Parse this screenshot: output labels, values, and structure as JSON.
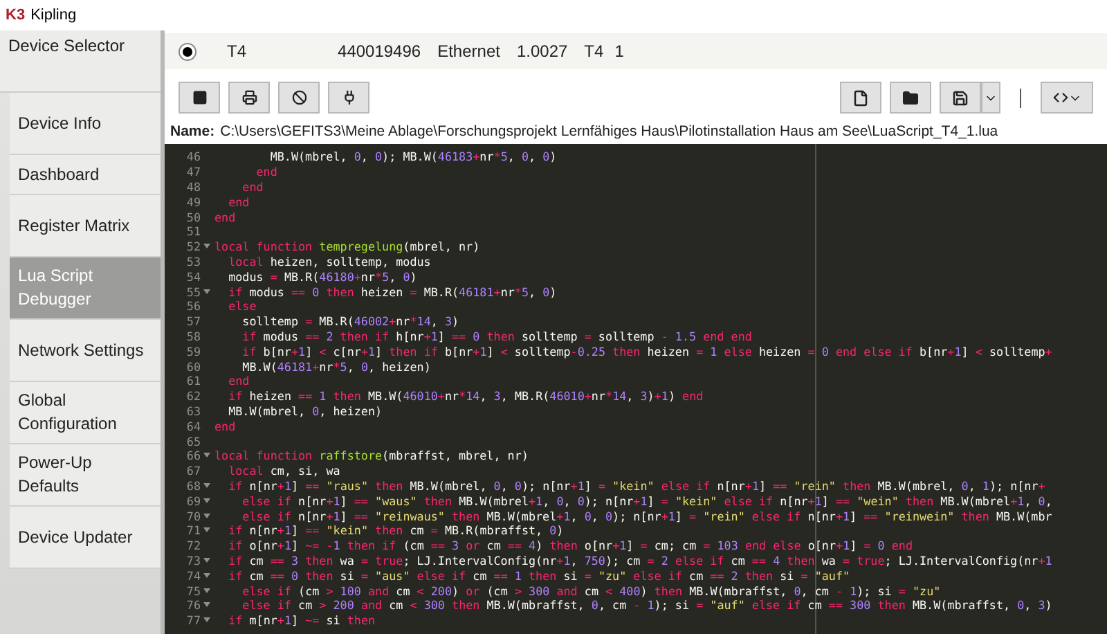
{
  "window": {
    "title": "Kipling",
    "logo": "K3"
  },
  "sidebar": {
    "header": "Device Selector",
    "items": [
      {
        "label": "Device Info",
        "selected": false
      },
      {
        "label": "Dashboard",
        "selected": false
      },
      {
        "label": "Register Matrix",
        "selected": false
      },
      {
        "label": "Lua Script Debugger",
        "selected": true
      },
      {
        "label": "Network Settings",
        "selected": false
      },
      {
        "label": "Global Configuration",
        "selected": false
      },
      {
        "label": "Power-Up Defaults",
        "selected": false
      },
      {
        "label": "Device Updater",
        "selected": false
      }
    ]
  },
  "device": {
    "selected": true,
    "columns": [
      "T4",
      "440019496",
      "Ethernet",
      "1.0027",
      "T4",
      "1"
    ]
  },
  "file": {
    "label": "Name:",
    "path": "C:\\Users\\GEFITS3\\Meine Ablage\\Forschungsprojekt Lernfähiges Haus\\Pilotinstallation Haus am See\\LuaScript_T4_1.lua"
  },
  "editor": {
    "lines": [
      {
        "number": "46",
        "fold": false,
        "code": "        MB.W(mbrel, 0, 0); MB.W(46183+nr*5, 0, 0)"
      },
      {
        "number": "47",
        "fold": false,
        "code": "      end"
      },
      {
        "number": "48",
        "fold": false,
        "code": "    end"
      },
      {
        "number": "49",
        "fold": false,
        "code": "  end"
      },
      {
        "number": "50",
        "fold": false,
        "code": "end"
      },
      {
        "number": "51",
        "fold": false
      },
      {
        "number": "52",
        "fold": true,
        "code": "local function tempregelung(mbrel, nr)"
      },
      {
        "number": "53",
        "fold": false,
        "code": "  local heizen, solltemp, modus"
      },
      {
        "number": "54",
        "fold": false,
        "code": "  modus = MB.R(46180+nr*5, 0)"
      },
      {
        "number": "55",
        "fold": true,
        "code": "  if modus == 0 then heizen = MB.R(46181+nr*5, 0)"
      },
      {
        "number": "56",
        "fold": false,
        "code": "  else"
      },
      {
        "number": "57",
        "fold": false,
        "code": "    solltemp = MB.R(46002+nr*14, 3)"
      },
      {
        "number": "58",
        "fold": false,
        "code": "    if modus == 2 then if h[nr+1] == 0 then solltemp = solltemp - 1.5 end end"
      },
      {
        "number": "59",
        "fold": false,
        "code": "    if b[nr+1] < c[nr+1] then if b[nr+1] < solltemp-0.25 then heizen = 1 else heizen = 0 end else if b[nr+1] < solltemp+"
      },
      {
        "number": "60",
        "fold": false,
        "code": "    MB.W(46181+nr*5, 0, heizen)"
      },
      {
        "number": "61",
        "fold": false,
        "code": "  end"
      },
      {
        "number": "62",
        "fold": false,
        "code": "  if heizen == 1 then MB.W(46010+nr*14, 3, MB.R(46010+nr*14, 3)+1) end"
      },
      {
        "number": "63",
        "fold": false,
        "code": "  MB.W(mbrel, 0, heizen)"
      },
      {
        "number": "64",
        "fold": false,
        "code": "end"
      },
      {
        "number": "65",
        "fold": false
      },
      {
        "number": "66",
        "fold": true,
        "code": "local function raffstore(mbraffst, mbrel, nr)"
      },
      {
        "number": "67",
        "fold": false,
        "code": "  local cm, si, wa"
      },
      {
        "number": "68",
        "fold": true,
        "code": "  if n[nr+1] == \"raus\" then MB.W(mbrel, 0, 0); n[nr+1] = \"kein\" else if n[nr+1] == \"rein\" then MB.W(mbrel, 0, 1); n[nr+"
      },
      {
        "number": "69",
        "fold": true,
        "code": "    else if n[nr+1] == \"waus\" then MB.W(mbrel+1, 0, 0); n[nr+1] = \"kein\" else if n[nr+1] == \"wein\" then MB.W(mbrel+1, 0,"
      },
      {
        "number": "70",
        "fold": true,
        "code": "    else if n[nr+1] == \"reinwaus\" then MB.W(mbrel+1, 0, 0); n[nr+1] = \"rein\" else if n[nr+1] == \"reinwein\" then MB.W(mbr"
      },
      {
        "number": "71",
        "fold": true,
        "code": "  if n[nr+1] == \"kein\" then cm = MB.R(mbraffst, 0)"
      },
      {
        "number": "72",
        "fold": false,
        "code": "  if o[nr+1] ~= -1 then if (cm == 3 or cm == 4) then o[nr+1] = cm; cm = 103 end else o[nr+1] = 0 end"
      },
      {
        "number": "73",
        "fold": true,
        "code": "  if cm == 3 then wa = true; LJ.IntervalConfig(nr+1, 750); cm = 2 else if cm == 4 then wa = true; LJ.IntervalConfig(nr+1"
      },
      {
        "number": "74",
        "fold": true,
        "code": "  if cm == 0 then si = \"aus\" else if cm == 1 then si = \"zu\" else if cm == 2 then si = \"auf\""
      },
      {
        "number": "75",
        "fold": true,
        "code": "    else if (cm > 100 and cm < 200) or (cm > 300 and cm < 400) then MB.W(mbraffst, 0, cm - 1); si = \"zu\""
      },
      {
        "number": "76",
        "fold": true,
        "code": "    else if cm > 200 and cm < 300 then MB.W(mbraffst, 0, cm - 1); si = \"auf\" else if cm == 300 then MB.W(mbraffst, 0, 3)"
      },
      {
        "number": "77",
        "fold": true,
        "code": "  if m[nr+1] ~= si then"
      }
    ]
  }
}
